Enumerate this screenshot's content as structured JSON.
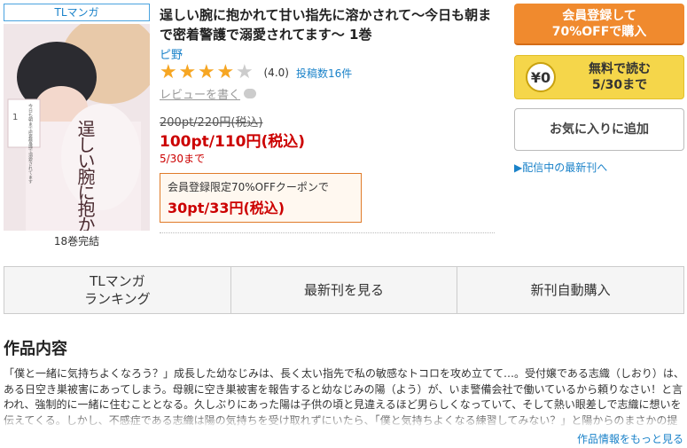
{
  "product": {
    "genre_tag": "TLマンガ",
    "title": "逞しい腕に抱かれて甘い指先に溶かされて～今日も朝まで密着警護で溺愛されてます～ 1巻",
    "author": "ピ野",
    "rating": 4.0,
    "rating_text": "(4.0)",
    "review_count": "投稿数16件",
    "write_review": "レビューを書く",
    "original_price": "200pt/220円(税込)",
    "sale_price": "100pt/110円(税込)",
    "sale_until": "5/30まで",
    "coupon_label": "会員登録限定70%OFFクーポンで",
    "coupon_price": "30pt/33円(税込)",
    "volumes_complete": "18巻完結",
    "cover_text": {
      "title_vertical": "逞しい腕に抱かれて甘い指先に溶かされて",
      "volume_mark": "1",
      "small_caption": "今日も朝まで密着警護で溺愛されてます"
    }
  },
  "actions": {
    "register_line1": "会員登録して",
    "register_line2": "70%OFFで購入",
    "free_coin": "¥0",
    "free_line1": "無料で読む",
    "free_line2": "5/30まで",
    "favorite": "お気に入りに追加",
    "latest_link": "▶配信中の最新刊へ"
  },
  "tabs": [
    {
      "label": "TLマンガ\nランキング"
    },
    {
      "label": "最新刊を見る"
    },
    {
      "label": "新刊自動購入"
    }
  ],
  "description": {
    "heading": "作品内容",
    "text": "「僕と一緒に気持ちよくなろう？」成長した幼なじみは、長く太い指先で私の敏感なトコロを攻め立てて…。受付嬢である志織（しおり）は、ある日空き巣被害にあってしまう。母親に空き巣被害を報告すると幼なじみの陽（よう）が、いま警備会社で働いているから頼りなさい！と言われ、強制的に一緒に住むこととなる。久しぶりにあった陽は子供の頃と見違えるほど男らしくなっていて、そして熱い眼差しで志織に想いを伝えてくる。しかし、不感症である志織は陽の気持ちを受け取れずにいたら、「僕と気持ちよくなる練習してみない？」と陽からのまさかの提",
    "more": "作品情報をもっと見る"
  },
  "colors": {
    "accent_orange": "#f08a2e",
    "free_yellow": "#f5d64a",
    "link_blue": "#1a82c9",
    "price_red": "#cc0000",
    "star_gold": "#f6a623"
  }
}
